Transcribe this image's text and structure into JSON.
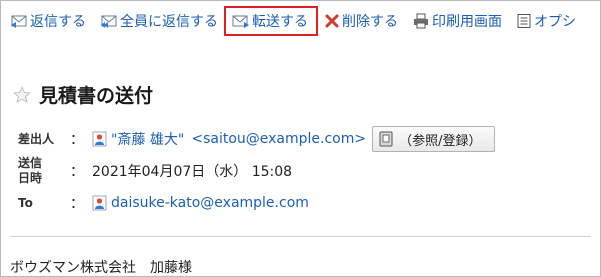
{
  "toolbar": {
    "reply": "返信する",
    "reply_all": "全員に返信する",
    "forward": "転送する",
    "delete": "削除する",
    "print": "印刷用画面",
    "options": "オプシ"
  },
  "message": {
    "subject": "見積書の送付",
    "from_label": "差出人",
    "from_name": "\"斎藤 雄大\"",
    "from_email": "<saitou@example.com>",
    "addressbook_button": "（参照/登録）",
    "sent_label": "送信日時",
    "sent_value": "2021年04月07日（水） 15:08",
    "to_label": "To",
    "to_email": "daisuke-kato@example.com",
    "colon": "：",
    "body_company": "ボウズマン株式会社",
    "body_name": "加藤様"
  },
  "colors": {
    "link": "#1a5fb4",
    "highlight": "#e02020"
  }
}
